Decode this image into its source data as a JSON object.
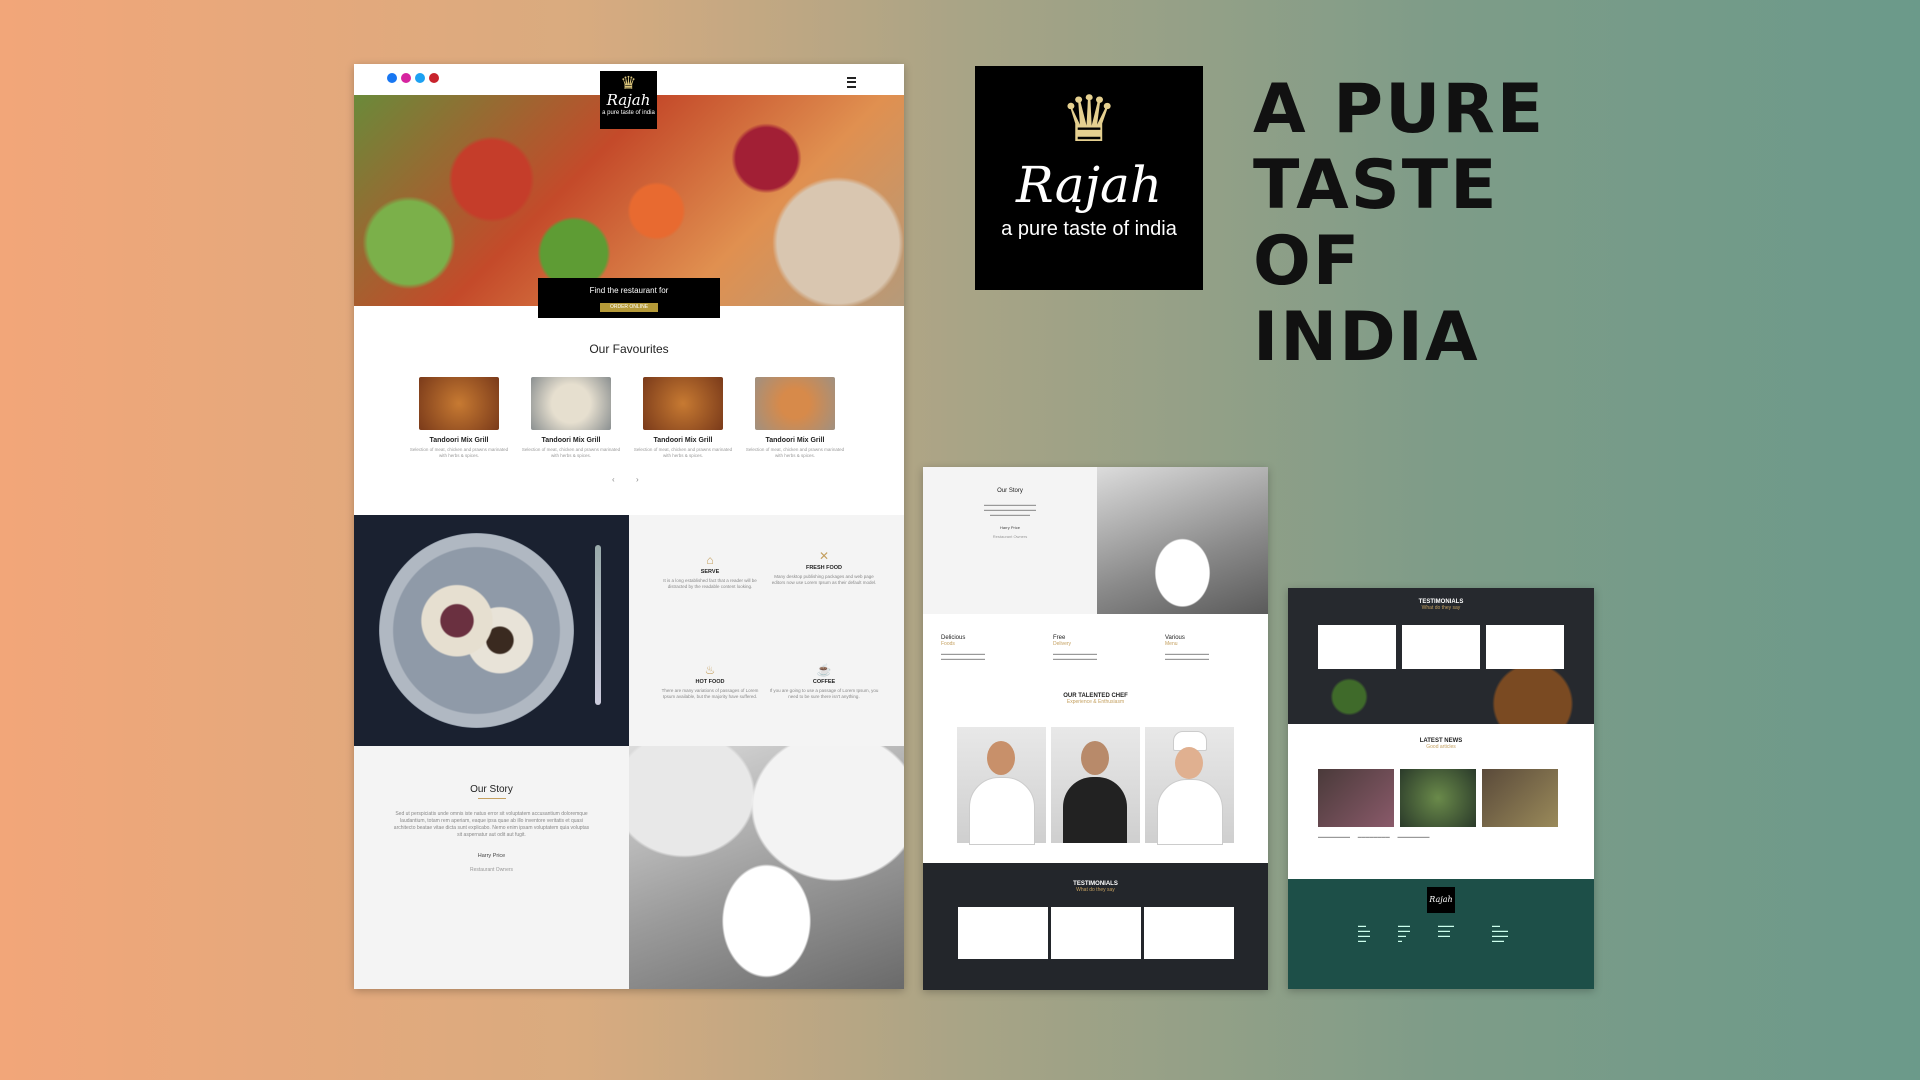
{
  "brand": {
    "logo_name": "Rajah",
    "logo_tagline": "a pure taste of india"
  },
  "tagline": "A PURE TASTE OF INDIA",
  "main": {
    "social_icons": [
      "facebook-icon",
      "instagram-icon",
      "twitter-icon",
      "pinterest-icon"
    ],
    "menu_icon": "hamburger-menu-icon",
    "hero_cta": {
      "text": "Find the restaurant for",
      "button": "ORDER ONLINE"
    },
    "favourites": {
      "title": "Our Favourites",
      "items": [
        {
          "name": "Tandoori Mix Grill",
          "desc": "Selection of meat, chicken and prawns marinated with herbs & spices."
        },
        {
          "name": "Tandoori Mix Grill",
          "desc": "Selection of meat, chicken and prawns marinated with herbs & spices."
        },
        {
          "name": "Tandoori Mix Grill",
          "desc": "Selection of meat, chicken and prawns marinated with herbs & spices."
        },
        {
          "name": "Tandoori Mix Grill",
          "desc": "Selection of meat, chicken and prawns marinated with herbs & spices."
        }
      ],
      "prev": "‹",
      "next": "›"
    },
    "features": [
      {
        "title": "SERVE",
        "desc": "It is a long established fact that a reader will be distracted by the readable content looking."
      },
      {
        "title": "FRESH FOOD",
        "desc": "Many desktop publishing packages and web page editors now use Lorem Ipsum as their default model."
      },
      {
        "title": "HOT FOOD",
        "desc": "There are many variations of passages of Lorem Ipsum available, but the majority have suffered."
      },
      {
        "title": "COFFEE",
        "desc": "If you are going to use a passage of Lorem Ipsum, you need to be sure there isn't anything."
      }
    ],
    "story": {
      "title": "Our Story",
      "text": "Sed ut perspiciatis unde omnis iste natus error sit voluptatem accusantium doloremque laudantium, totam rem aperiam, eaque ipsa quae ab illo inventore veritatis et quasi architecto beatae vitae dicta sunt explicabo. Nemo enim ipsam voluptatem quia voluptas sit aspernatur aut odit aut fugit.",
      "author": "Harry Price",
      "role": "Restaurant Owners"
    }
  },
  "mockup2": {
    "story": {
      "title": "Our Story",
      "author": "Harry Price",
      "role": "Restaurant Owners"
    },
    "cols": [
      {
        "title": "Delicious",
        "sub": "Foods"
      },
      {
        "title": "Free",
        "sub": "Delivery"
      },
      {
        "title": "Various",
        "sub": "Menu"
      }
    ],
    "chef": {
      "title": "OUR TALENTED CHEF",
      "sub": "Experience & Enthusiasm"
    },
    "testimonials": {
      "title": "TESTIMONIALS",
      "sub": "What do they say"
    }
  },
  "mockup3": {
    "testimonials": {
      "title": "TESTIMONIALS",
      "sub": "What do they say"
    },
    "news": {
      "title": "LATEST NEWS",
      "sub": "Good articles"
    },
    "footer_logo": "Rajah"
  },
  "colors": {
    "accent": "#c4a060",
    "footer": "#1d4f48",
    "dark": "#23262b"
  }
}
